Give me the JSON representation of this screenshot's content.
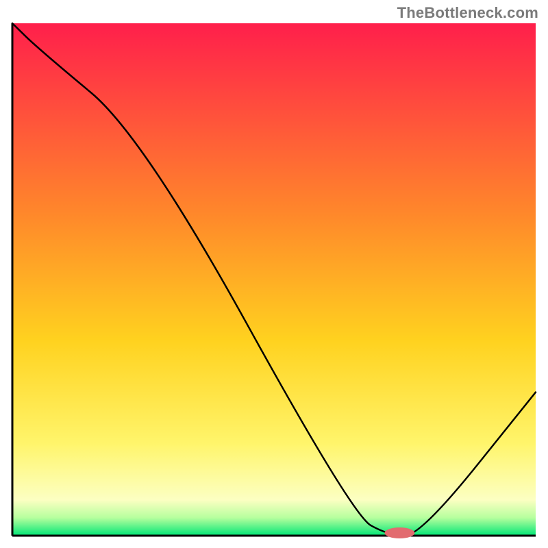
{
  "watermark": "TheBottleneck.com",
  "chart_data": {
    "type": "line",
    "title": "",
    "xlabel": "",
    "ylabel": "",
    "xlim": [
      0,
      100
    ],
    "ylim": [
      0,
      100
    ],
    "x": [
      0,
      5,
      25,
      65,
      72,
      78,
      100
    ],
    "values": [
      100,
      95,
      78,
      4,
      0,
      0,
      28
    ],
    "annotations": [],
    "gradient_stops": [
      {
        "offset": 0.0,
        "color": "#ff1f4b"
      },
      {
        "offset": 0.38,
        "color": "#ff8a2a"
      },
      {
        "offset": 0.62,
        "color": "#ffd21f"
      },
      {
        "offset": 0.82,
        "color": "#fff56b"
      },
      {
        "offset": 0.93,
        "color": "#fcffc2"
      },
      {
        "offset": 0.965,
        "color": "#b6ff9e"
      },
      {
        "offset": 1.0,
        "color": "#00e676"
      }
    ],
    "marker": {
      "x": 74,
      "y": 0,
      "color": "#e26b6f",
      "rx": 6,
      "ry": 3
    }
  },
  "plot": {
    "margin_top": 34,
    "margin_right": 18,
    "margin_bottom": 18,
    "margin_left": 18,
    "axis_stroke": "#000",
    "axis_width": 3,
    "curve_stroke": "#000",
    "curve_width": 2.5
  }
}
